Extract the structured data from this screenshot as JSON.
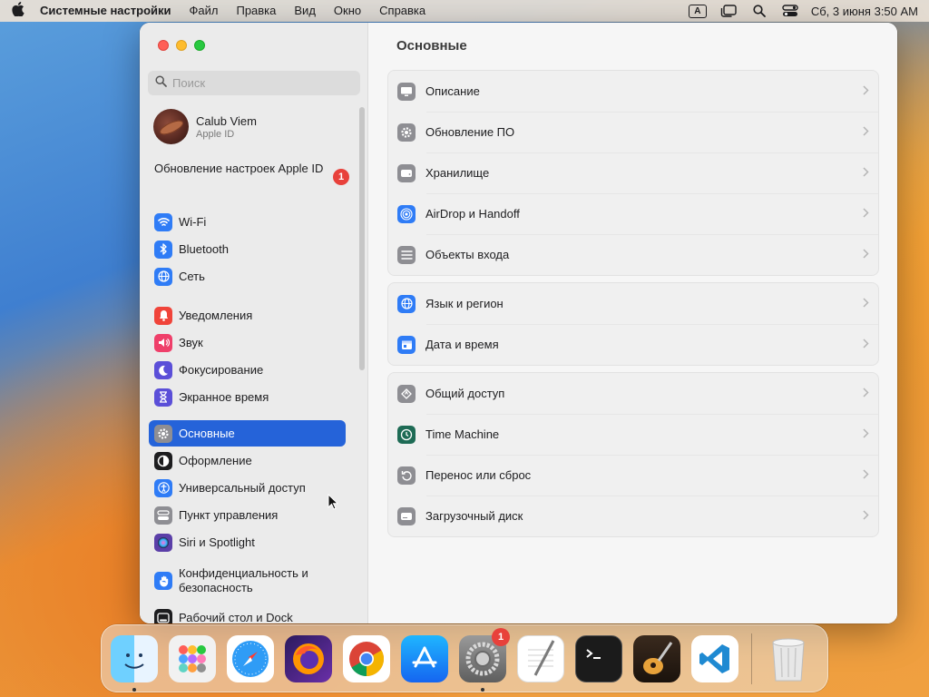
{
  "menubar": {
    "app_name": "Системные настройки",
    "menus": [
      "Файл",
      "Правка",
      "Вид",
      "Окно",
      "Справка"
    ],
    "input_indicator": "A",
    "clock": "Сб, 3 июня  3:50 AM"
  },
  "window": {
    "search": {
      "placeholder": "Поиск",
      "value": ""
    },
    "profile": {
      "name": "Calub Viem",
      "subtitle": "Apple ID"
    },
    "update_notice": {
      "label": "Обновление настроек Apple ID",
      "badge": "1"
    },
    "sidebar": {
      "items": [
        {
          "label": "Wi-Fi",
          "icon": "wifi-icon",
          "color": "#2f7cf6"
        },
        {
          "label": "Bluetooth",
          "icon": "bluetooth-icon",
          "color": "#2f7cf6"
        },
        {
          "label": "Сеть",
          "icon": "globe-icon",
          "color": "#2f7cf6"
        },
        {
          "label": "Уведомления",
          "icon": "bell-icon",
          "color": "#f0443a"
        },
        {
          "label": "Звук",
          "icon": "speaker-icon",
          "color": "#ef3f6a"
        },
        {
          "label": "Фокусирование",
          "icon": "moon-icon",
          "color": "#5b4fd8"
        },
        {
          "label": "Экранное время",
          "icon": "hourglass-icon",
          "color": "#5b4fd8"
        },
        {
          "label": "Основные",
          "icon": "gear-icon",
          "color": "#8e8e93",
          "active": true
        },
        {
          "label": "Оформление",
          "icon": "appearance-icon",
          "color": "#1d1d1f"
        },
        {
          "label": "Универсальный доступ",
          "icon": "accessibility-icon",
          "color": "#2f7cf6"
        },
        {
          "label": "Пункт управления",
          "icon": "control-center-icon",
          "color": "#8e8e93"
        },
        {
          "label": "Siri и Spotlight",
          "icon": "siri-icon",
          "color": "#5b3fa8"
        },
        {
          "label": "Конфиденциальность и безопасность",
          "icon": "hand-icon",
          "color": "#2f7cf6"
        },
        {
          "label": "Рабочий стол и Dock",
          "icon": "dock-icon",
          "color": "#1d1d1f"
        }
      ]
    },
    "content": {
      "title": "Основные",
      "groups": [
        [
          {
            "label": "Описание",
            "icon": "display-icon",
            "color": "#8e8e93"
          },
          {
            "label": "Обновление ПО",
            "icon": "software-update-icon",
            "color": "#8e8e93"
          },
          {
            "label": "Хранилище",
            "icon": "storage-icon",
            "color": "#8e8e93"
          },
          {
            "label": "AirDrop и Handoff",
            "icon": "airdrop-icon",
            "color": "#2f7cf6"
          },
          {
            "label": "Объекты входа",
            "icon": "login-items-icon",
            "color": "#8e8e93"
          }
        ],
        [
          {
            "label": "Язык и регион",
            "icon": "globe-icon",
            "color": "#2f7cf6"
          },
          {
            "label": "Дата и время",
            "icon": "calendar-icon",
            "color": "#2f7cf6"
          }
        ],
        [
          {
            "label": "Общий доступ",
            "icon": "sharing-icon",
            "color": "#8e8e93"
          },
          {
            "label": "Time Machine",
            "icon": "time-machine-icon",
            "color": "#1e6b55"
          },
          {
            "label": "Перенос или сброс",
            "icon": "reset-icon",
            "color": "#8e8e93"
          },
          {
            "label": "Загрузочный диск",
            "icon": "startup-disk-icon",
            "color": "#8e8e93"
          }
        ]
      ]
    }
  },
  "dock": {
    "apps": [
      {
        "name": "finder-icon",
        "running": true
      },
      {
        "name": "launchpad-icon"
      },
      {
        "name": "safari-icon"
      },
      {
        "name": "firefox-icon"
      },
      {
        "name": "chrome-icon"
      },
      {
        "name": "app-store-icon"
      },
      {
        "name": "system-settings-icon",
        "badge": "1",
        "running": true
      },
      {
        "name": "textedit-icon"
      },
      {
        "name": "terminal-icon"
      },
      {
        "name": "garageband-icon"
      },
      {
        "name": "vscode-icon"
      }
    ],
    "trash": "trash-icon"
  }
}
